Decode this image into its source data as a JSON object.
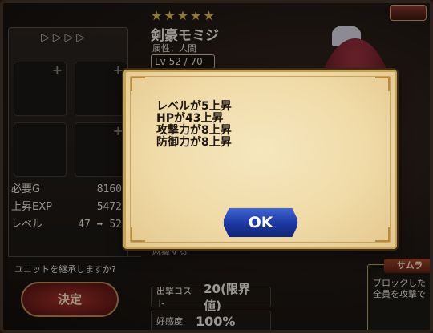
{
  "header": {
    "stars": "★★★★★",
    "unit_name": "剣豪モミジ",
    "attribute": "属性：人間",
    "level_text": "Lv 52 / 70"
  },
  "left_panel": {
    "arrows": "▷▷▷▷",
    "stats": [
      {
        "label": "必要G",
        "value": "8160"
      },
      {
        "label": "上昇EXP",
        "value": "5472"
      },
      {
        "label": "レベル",
        "value": "47 ➡ 52"
      }
    ],
    "prompt": "ユニットを継承しますか?",
    "decide_label": "決定"
  },
  "info": {
    "skill_text": "麻痺する",
    "cost_label": "出撃コスト",
    "cost_value": "20(限界値)",
    "favor_label": "好感度",
    "favor_value": "100%",
    "ability_title": "サムラ",
    "ability_desc": "ブロックした\n全員を攻撃で"
  },
  "dialog": {
    "lines": [
      "レベルが5上昇",
      "HPが43上昇",
      "攻撃力が8上昇",
      "防御力が8上昇"
    ],
    "ok_label": "OK"
  }
}
